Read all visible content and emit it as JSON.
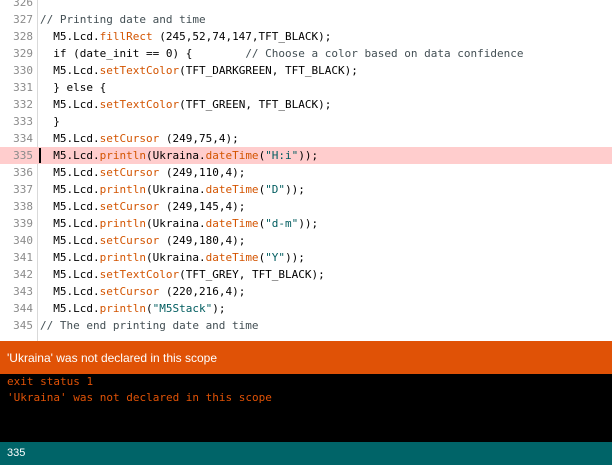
{
  "editor": {
    "highlight_color": "#ffcdcd",
    "lines": [
      {
        "no": "326",
        "text": ""
      },
      {
        "no": "327",
        "text": "// Printing date and time"
      },
      {
        "no": "328",
        "text": "  M5.Lcd.fillRect (245,52,74,147,TFT_BLACK);"
      },
      {
        "no": "329",
        "text": "  if (date_init == 0) {        // Choose a color based on data confidence"
      },
      {
        "no": "330",
        "text": "  M5.Lcd.setTextColor(TFT_DARKGREEN, TFT_BLACK);"
      },
      {
        "no": "331",
        "text": "  } else {"
      },
      {
        "no": "332",
        "text": "  M5.Lcd.setTextColor(TFT_GREEN, TFT_BLACK);"
      },
      {
        "no": "333",
        "text": "  }"
      },
      {
        "no": "334",
        "text": "  M5.Lcd.setCursor (249,75,4);"
      },
      {
        "no": "335",
        "text": "  M5.Lcd.println(Ukraina.dateTime(\"H:i\"));",
        "highlight": true
      },
      {
        "no": "336",
        "text": "  M5.Lcd.setCursor (249,110,4);"
      },
      {
        "no": "337",
        "text": "  M5.Lcd.println(Ukraina.dateTime(\"D\"));"
      },
      {
        "no": "338",
        "text": "  M5.Lcd.setCursor (249,145,4);"
      },
      {
        "no": "339",
        "text": "  M5.Lcd.println(Ukraina.dateTime(\"d-m\"));"
      },
      {
        "no": "340",
        "text": "  M5.Lcd.setCursor (249,180,4);"
      },
      {
        "no": "341",
        "text": "  M5.Lcd.println(Ukraina.dateTime(\"Y\"));"
      },
      {
        "no": "342",
        "text": "  M5.Lcd.setTextColor(TFT_GREY, TFT_BLACK);"
      },
      {
        "no": "343",
        "text": "  M5.Lcd.setCursor (220,216,4);"
      },
      {
        "no": "344",
        "text": "  M5.Lcd.println(\"M5Stack\");"
      },
      {
        "no": "345",
        "text": "// The end printing date and time"
      }
    ]
  },
  "error_banner": {
    "message": "'Ukraina' was not declared in this scope",
    "color": "#e05206"
  },
  "console": {
    "lines": [
      "exit status 1",
      "'Ukraina' was not declared in this scope"
    ]
  },
  "status_bar": {
    "line_number": "335",
    "color": "#006468"
  }
}
